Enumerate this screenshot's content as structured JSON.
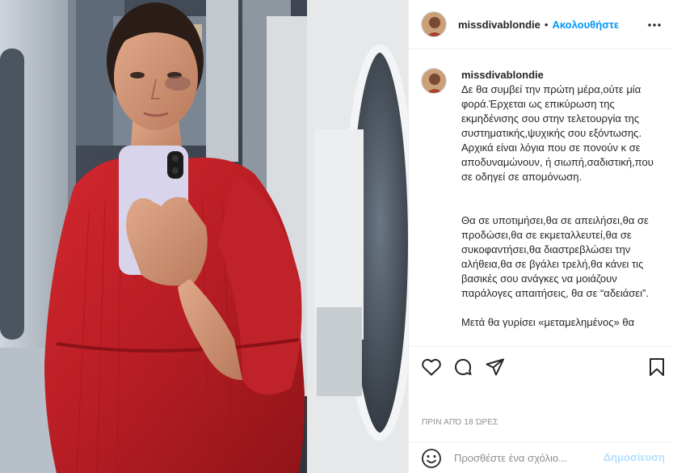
{
  "post": {
    "username": "missdivablondie",
    "follow_separator": "•",
    "follow_label": "Ακολουθήστε",
    "caption_paragraphs": [
      "Δε θα συμβεί την πρώτη μέρα,ούτε μία φορά.Έρχεται ως επικύρωση της εκμηδένισης σου στην τελετουργία της συστηματικής,ψυχικής σου εξόντωσης. Αρχικά είναι λόγια που σε πονούν κ σε αποδυναμώνουν, ή σιωπή,σαδιστική,που σε οδηγεί σε απομόνωση.",
      "Θα σε υποτιμήσει,θα σε απειλήσει,θα σε προδώσει,θα σε εκμεταλλευτεί,θα σε συκοφαντήσει,θα διαστρεβλώσει την αλήθεια,θα σε βγάλει τρελή,θα κάνει τις βασικές σου ανάγκες να μοιάζουν παράλογες απαιτήσεις, θα σε “αδειάσει”.",
      "Μετά θα γυρίσει «μεταμελημένος» θα"
    ],
    "time_ago": "ΠΡΙΝ ΑΠΌ 18 ΏΡΕΣ"
  },
  "comment_box": {
    "placeholder": "Προσθέστε ένα σχόλιο...",
    "post_label": "Δημοσίευση"
  },
  "icons": {
    "more": "more-horizontal-icon",
    "like": "heart-icon",
    "comment": "comment-bubble-icon",
    "share": "paper-plane-icon",
    "save": "bookmark-icon",
    "emoji": "emoji-smiley-icon"
  },
  "colors": {
    "link_blue": "#0095f6",
    "post_disabled": "#b2dffc",
    "muted_text": "#8e8e8e",
    "border": "#efefef"
  }
}
